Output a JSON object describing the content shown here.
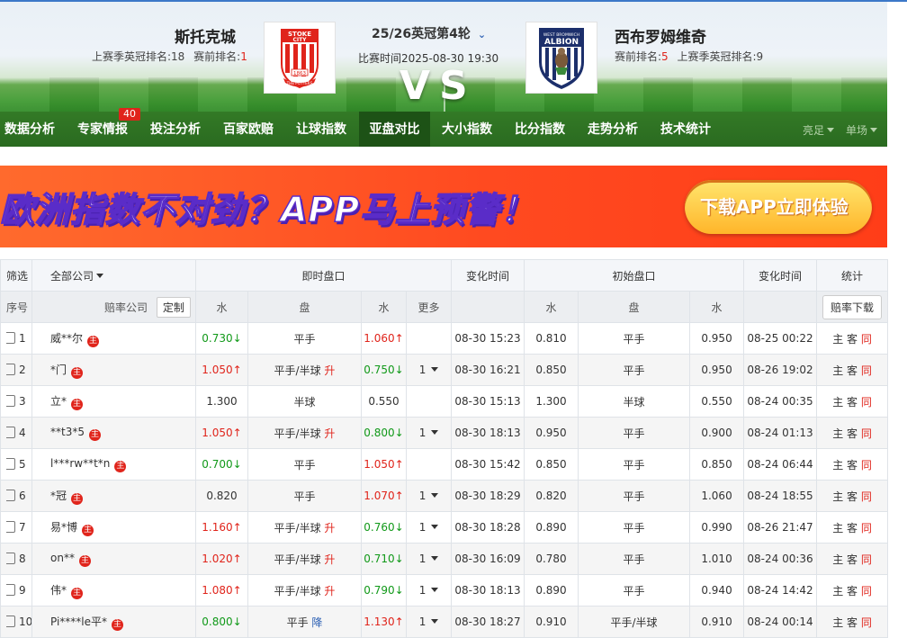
{
  "match": {
    "round": "25/26英冠第4轮",
    "match_time": "比赛时间2025-08-30 19:30",
    "vs": "VS",
    "home": {
      "name": "斯托克城",
      "last_rank_label": "上赛季英冠排名:18",
      "current_rank_label": "赛前排名:",
      "current_rank": "1"
    },
    "away": {
      "name": "西布罗姆维奇",
      "current_rank_label": "赛前排名:",
      "current_rank": "5",
      "last_rank_label": "上赛季英冠排名:9"
    }
  },
  "logos": {
    "home": {
      "text_top": "STOKE",
      "text_mid": "CITY",
      "year": "1863",
      "motto": "THE POTTERS",
      "colors": {
        "red": "#e0241b",
        "white": "#ffffff"
      }
    },
    "away": {
      "text_top": "WEST BROMWICH",
      "text_mid": "ALBION",
      "colors": {
        "navy": "#1c2f6b",
        "white": "#ffffff"
      }
    }
  },
  "nav": {
    "badge": "40",
    "items": [
      "数据分析",
      "专家情报",
      "投注分析",
      "百家欧赔",
      "让球指数",
      "亚盘对比",
      "大小指数",
      "比分指数",
      "走势分析",
      "技术统计"
    ],
    "active_index": 5,
    "right": [
      "亮足",
      "单场"
    ]
  },
  "banner": {
    "text": "欧洲指数不对劲？APP马上预警！",
    "button": "下载APP立即体验"
  },
  "table": {
    "header1": {
      "filter": "筛选",
      "company": "全部公司",
      "live": "即时盘口",
      "change_time": "变化时间",
      "initial": "初始盘口",
      "change_time2": "变化时间",
      "stats": "统计"
    },
    "header2": {
      "index": "序号",
      "company": "赔率公司",
      "customize": "定制",
      "water1": "水",
      "handicap": "盘",
      "water2": "水",
      "more": "更多",
      "init_water1": "水",
      "init_handicap": "盘",
      "init_water2": "水",
      "download": "赔率下载"
    },
    "zhu_label": "主",
    "stats_labels": [
      "主",
      "客",
      "同"
    ],
    "rows": [
      {
        "idx": "1",
        "company": "威**尔",
        "w1": "0.730",
        "w1_trend": "↓",
        "handicap": "平手",
        "hc_change": "",
        "w2": "1.060",
        "w2_trend": "↑",
        "more": "",
        "time": "08-30 15:23",
        "iw1": "0.810",
        "ih": "平手",
        "iw2": "0.950",
        "itime": "08-25 00:22"
      },
      {
        "idx": "2",
        "company": "*门",
        "w1": "1.050",
        "w1_trend": "↑",
        "handicap": "平手/半球",
        "hc_change": "升",
        "w2": "0.750",
        "w2_trend": "↓",
        "more": "1",
        "time": "08-30 16:21",
        "iw1": "0.850",
        "ih": "平手",
        "iw2": "0.950",
        "itime": "08-26 19:02"
      },
      {
        "idx": "3",
        "company": "立*",
        "w1": "1.300",
        "w1_trend": "",
        "handicap": "半球",
        "hc_change": "",
        "w2": "0.550",
        "w2_trend": "",
        "more": "",
        "time": "08-30 15:13",
        "iw1": "1.300",
        "ih": "半球",
        "iw2": "0.550",
        "itime": "08-24 00:35"
      },
      {
        "idx": "4",
        "company": "**t3*5",
        "w1": "1.050",
        "w1_trend": "↑",
        "handicap": "平手/半球",
        "hc_change": "升",
        "w2": "0.800",
        "w2_trend": "↓",
        "more": "1",
        "time": "08-30 18:13",
        "iw1": "0.950",
        "ih": "平手",
        "iw2": "0.900",
        "itime": "08-24 01:13"
      },
      {
        "idx": "5",
        "company": "l***rw**t*n",
        "w1": "0.700",
        "w1_trend": "↓",
        "handicap": "平手",
        "hc_change": "",
        "w2": "1.050",
        "w2_trend": "↑",
        "more": "",
        "time": "08-30 15:42",
        "iw1": "0.850",
        "ih": "平手",
        "iw2": "0.850",
        "itime": "08-24 06:44"
      },
      {
        "idx": "6",
        "company": "*冠",
        "w1": "0.820",
        "w1_trend": "",
        "handicap": "平手",
        "hc_change": "",
        "w2": "1.070",
        "w2_trend": "↑",
        "more": "1",
        "time": "08-30 18:29",
        "iw1": "0.820",
        "ih": "平手",
        "iw2": "1.060",
        "itime": "08-24 18:55"
      },
      {
        "idx": "7",
        "company": "易*博",
        "w1": "1.160",
        "w1_trend": "↑",
        "handicap": "平手/半球",
        "hc_change": "升",
        "w2": "0.760",
        "w2_trend": "↓",
        "more": "1",
        "time": "08-30 18:28",
        "iw1": "0.890",
        "ih": "平手",
        "iw2": "0.990",
        "itime": "08-26 21:47"
      },
      {
        "idx": "8",
        "company": "on**",
        "w1": "1.020",
        "w1_trend": "↑",
        "handicap": "平手/半球",
        "hc_change": "升",
        "w2": "0.710",
        "w2_trend": "↓",
        "more": "1",
        "time": "08-30 16:09",
        "iw1": "0.780",
        "ih": "平手",
        "iw2": "1.010",
        "itime": "08-24 00:36"
      },
      {
        "idx": "9",
        "company": "伟*",
        "w1": "1.080",
        "w1_trend": "↑",
        "handicap": "平手/半球",
        "hc_change": "升",
        "w2": "0.790",
        "w2_trend": "↓",
        "more": "1",
        "time": "08-30 18:13",
        "iw1": "0.890",
        "ih": "平手",
        "iw2": "0.940",
        "itime": "08-24 14:42"
      },
      {
        "idx": "10",
        "company": "Pi****le平*",
        "w1": "0.800",
        "w1_trend": "↓",
        "handicap": "平手",
        "hc_change": "降",
        "w2": "1.130",
        "w2_trend": "↑",
        "more": "1",
        "time": "08-30 18:27",
        "iw1": "0.910",
        "ih": "平手/半球",
        "iw2": "0.910",
        "itime": "08-24 00:14"
      }
    ]
  },
  "colors": {
    "nav_green": "#2f7223",
    "accent_red": "#e0241b",
    "up_red": "#e0241b",
    "down_green": "#119919",
    "banner_orange": "#ff4a20"
  }
}
